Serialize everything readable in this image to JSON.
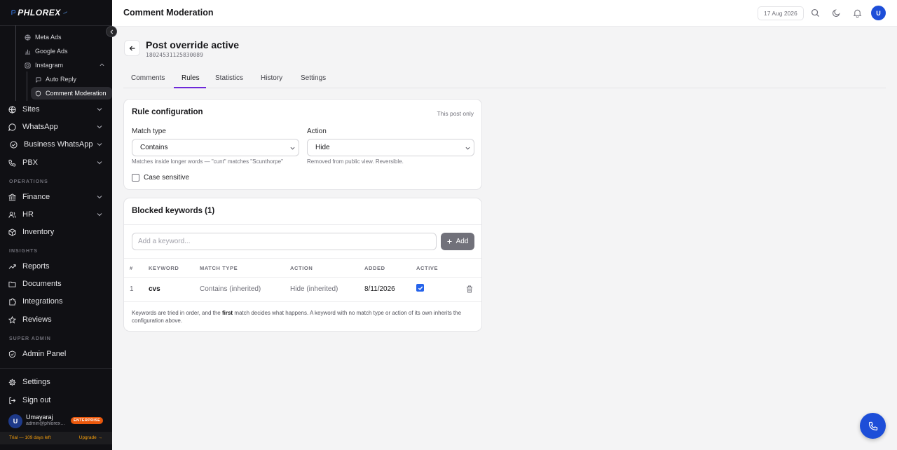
{
  "brand": {
    "logo_text": "PHLOREX"
  },
  "colors": {
    "accent": "#6d28d9",
    "sidebar_bg": "#101014",
    "primary": "#1d4ed8",
    "enterprise": "#ea580c",
    "trial": "#f59e0b"
  },
  "sidebar": {
    "sub_items": [
      {
        "label": "Meta Ads",
        "icon": "globe-icon"
      },
      {
        "label": "Google Ads",
        "icon": "bar-chart-icon"
      },
      {
        "label": "Instagram",
        "icon": "instagram-icon"
      },
      {
        "label": "Auto Reply",
        "icon": "message-icon"
      },
      {
        "label": "Comment Moderation",
        "icon": "shield-icon"
      }
    ],
    "nav_items": [
      {
        "label": "Sites",
        "icon": "globe-icon"
      },
      {
        "label": "WhatsApp",
        "icon": "chat-bubble-icon"
      },
      {
        "label": "Business WhatsApp",
        "icon": "check-circle-icon"
      },
      {
        "label": "PBX",
        "icon": "phone-icon"
      },
      {
        "label": "Finance",
        "icon": "bank-icon"
      },
      {
        "label": "HR",
        "icon": "users-icon"
      },
      {
        "label": "Inventory",
        "icon": "box-icon"
      },
      {
        "label": "Reports",
        "icon": "trend-icon"
      },
      {
        "label": "Documents",
        "icon": "folder-icon"
      },
      {
        "label": "Integrations",
        "icon": "puzzle-icon"
      },
      {
        "label": "Reviews",
        "icon": "star-icon"
      },
      {
        "label": "Admin Panel",
        "icon": "shield-icon"
      },
      {
        "label": "Settings",
        "icon": "gear-icon"
      },
      {
        "label": "Sign out",
        "icon": "logout-icon"
      }
    ],
    "sections": {
      "operations": "OPERATIONS",
      "insights": "INSIGHTS",
      "super_admin": "SUPER ADMIN"
    },
    "user": {
      "initial": "U",
      "name": "Umayaraj",
      "email": "admin@phlorex.com",
      "plan_badge": "ENTERPRISE"
    },
    "trial": {
      "text": "Trial — 109 days left",
      "upgrade": "Upgrade →"
    }
  },
  "topbar": {
    "title": "Comment Moderation",
    "date": "17 Aug 2026",
    "avatar_initial": "U"
  },
  "post": {
    "title": "Post override active",
    "id": "18024531125830089"
  },
  "tabs": [
    {
      "label": "Comments"
    },
    {
      "label": "Rules"
    },
    {
      "label": "Statistics"
    },
    {
      "label": "History"
    },
    {
      "label": "Settings"
    }
  ],
  "active_tab": "Rules",
  "rule_config": {
    "title": "Rule configuration",
    "note": "This post only",
    "match_type_label": "Match type",
    "match_type_value": "Contains",
    "match_type_hint": "Matches inside longer words — \"cunt\" matches \"Scunthorpe\"",
    "action_label": "Action",
    "action_value": "Hide",
    "action_hint": "Removed from public view. Reversible.",
    "case_sensitive_label": "Case sensitive",
    "case_sensitive_checked": false
  },
  "blocked": {
    "title": "Blocked keywords (1)",
    "input_placeholder": "Add a keyword...",
    "add_label": "Add",
    "columns": [
      "#",
      "KEYWORD",
      "MATCH TYPE",
      "ACTION",
      "ADDED",
      "ACTIVE"
    ],
    "rows": [
      {
        "index": "1",
        "keyword": "cvs",
        "match_type": "Contains (inherited)",
        "action": "Hide (inherited)",
        "added": "8/11/2026",
        "active": true
      }
    ],
    "footnote_pre": "Keywords are tried in order, and the ",
    "footnote_bold": "first",
    "footnote_post": " match decides what happens. A keyword with no match type or action of its own inherits the configuration above."
  }
}
